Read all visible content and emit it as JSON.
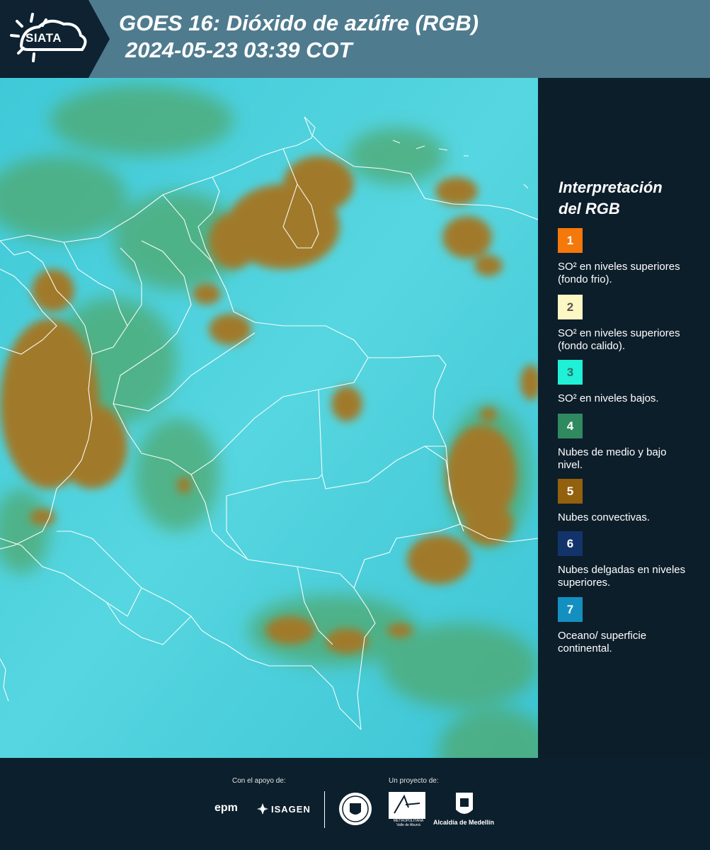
{
  "header": {
    "logo_text": "SIATA",
    "title_line1": "GOES 16: Dióxido de azúfre (RGB)",
    "title_line2": "2024-05-23 03:39 COT"
  },
  "legend": {
    "title_line1": "Interpretación",
    "title_line2": "del RGB",
    "items": [
      {
        "number": "1",
        "color": "#f5780a",
        "number_color": "#ffffff",
        "label": "SO² en niveles superiores (fondo frio)."
      },
      {
        "number": "2",
        "color": "#fdf7c4",
        "number_color": "#555555",
        "label": "SO² en niveles superiores (fondo calido)."
      },
      {
        "number": "3",
        "color": "#1ff0d6",
        "number_color": "#2f6f6a",
        "label": "SO² en niveles bajos."
      },
      {
        "number": "4",
        "color": "#2f8a60",
        "number_color": "#ffffff",
        "label": "Nubes de medio y bajo nivel."
      },
      {
        "number": "5",
        "color": "#93600d",
        "number_color": "#ffffff",
        "label": "Nubes convectivas."
      },
      {
        "number": "6",
        "color": "#12346a",
        "number_color": "#ffffff",
        "label": "Nubes delgadas en niveles superiores."
      },
      {
        "number": "7",
        "color": "#1390c0",
        "number_color": "#ffffff",
        "label": "Oceano/ superficie continental."
      }
    ]
  },
  "footer": {
    "support_label": "Con el apoyo de:",
    "project_label": "Un proyecto de:",
    "epm": "epm",
    "isagen": "ISAGEN",
    "area_sub": "METROPOLITANA Valle de Aburrá",
    "alcaldia": "Alcaldía de Medellín"
  }
}
